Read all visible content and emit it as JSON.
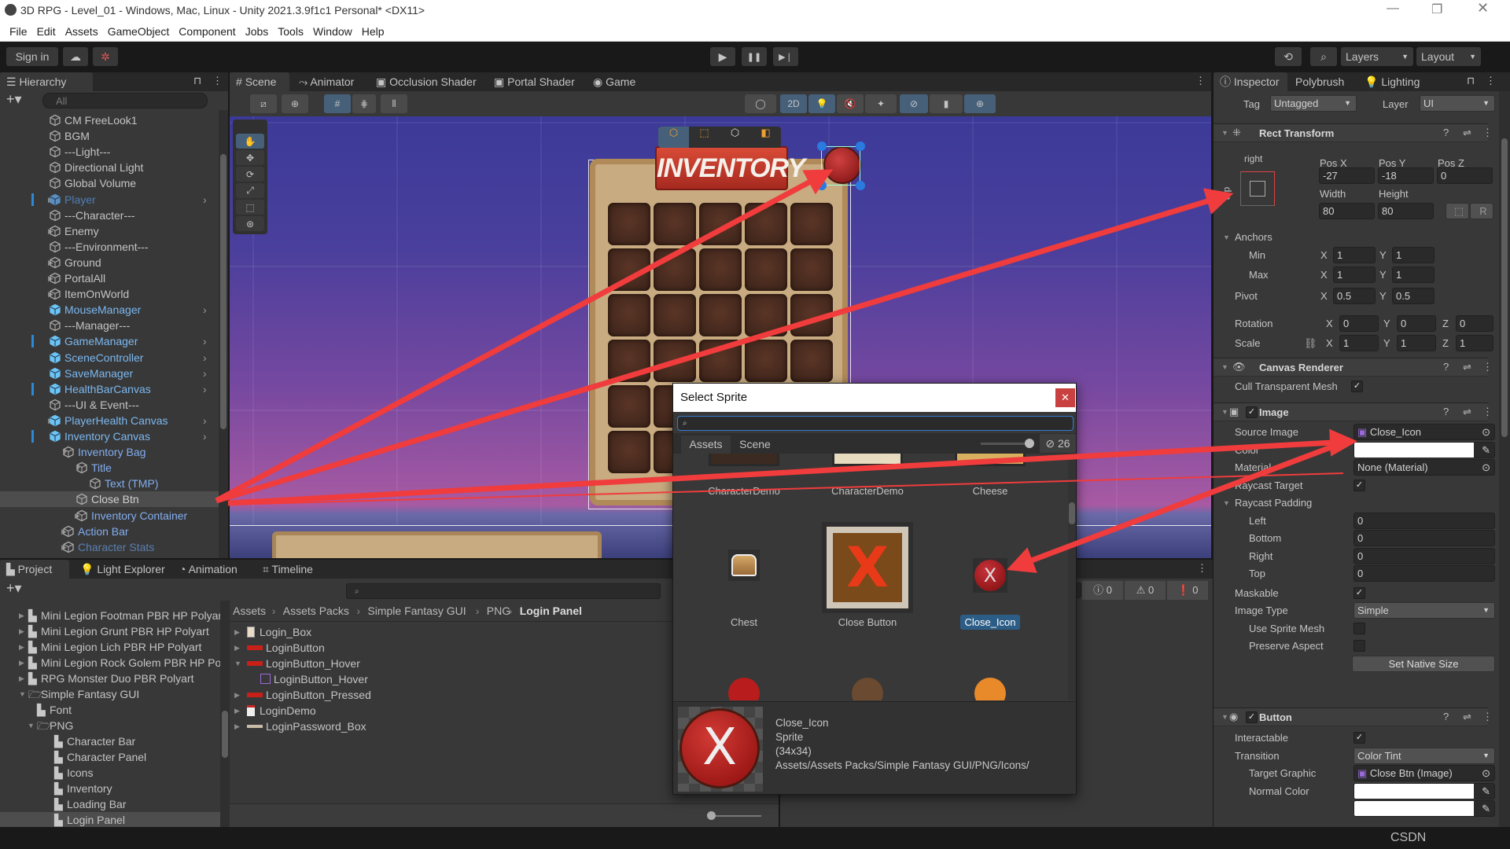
{
  "window": {
    "title": "3D RPG - Level_01 - Windows, Mac, Linux - Unity 2021.3.9f1c1 Personal* <DX11>"
  },
  "menu": [
    "File",
    "Edit",
    "Assets",
    "GameObject",
    "Component",
    "Jobs",
    "Tools",
    "Window",
    "Help"
  ],
  "toolbar": {
    "sign_in": "Sign in",
    "layers": "Layers",
    "layout": "Layout"
  },
  "hierarchy": {
    "tab": "Hierarchy",
    "search_placeholder": "All",
    "items": [
      {
        "label": "CM FreeLook1",
        "depth": 0,
        "kind": "normal"
      },
      {
        "label": "BGM",
        "depth": 0,
        "kind": "normal"
      },
      {
        "label": "---Light---",
        "depth": 0,
        "kind": "normal"
      },
      {
        "label": "Directional Light",
        "depth": 0,
        "kind": "normal"
      },
      {
        "label": "Global Volume",
        "depth": 0,
        "kind": "normal"
      },
      {
        "label": "Player",
        "depth": 0,
        "kind": "prefab-dim",
        "arrow": "right",
        "chevron": true,
        "bar": true
      },
      {
        "label": "---Character---",
        "depth": 0,
        "kind": "normal"
      },
      {
        "label": "Enemy",
        "depth": 0,
        "kind": "normal",
        "arrow": "right"
      },
      {
        "label": "---Environment---",
        "depth": 0,
        "kind": "normal"
      },
      {
        "label": "Ground",
        "depth": 0,
        "kind": "normal",
        "arrow": "right"
      },
      {
        "label": "PortalAll",
        "depth": 0,
        "kind": "normal",
        "arrow": "right"
      },
      {
        "label": "ItemOnWorld",
        "depth": 0,
        "kind": "normal",
        "arrow": "right"
      },
      {
        "label": "MouseManager",
        "depth": 0,
        "kind": "prefab",
        "chevron": true
      },
      {
        "label": "---Manager---",
        "depth": 0,
        "kind": "normal"
      },
      {
        "label": "GameManager",
        "depth": 0,
        "kind": "prefab",
        "chevron": true,
        "bar": true
      },
      {
        "label": "SceneController",
        "depth": 0,
        "kind": "prefab",
        "chevron": true
      },
      {
        "label": "SaveManager",
        "depth": 0,
        "kind": "prefab",
        "chevron": true
      },
      {
        "label": "HealthBarCanvas",
        "depth": 0,
        "kind": "prefab",
        "chevron": true,
        "bar": true
      },
      {
        "label": "---UI & Event---",
        "depth": 0,
        "kind": "normal"
      },
      {
        "label": "PlayerHealth Canvas",
        "depth": 0,
        "kind": "prefab",
        "arrow": "right",
        "chevron": true
      },
      {
        "label": "Inventory Canvas",
        "depth": 0,
        "kind": "prefab",
        "arrow": "down",
        "chevron": true,
        "bar": true
      },
      {
        "label": "Inventory Bag",
        "depth": 1,
        "kind": "child",
        "arrow": "down"
      },
      {
        "label": "Title",
        "depth": 2,
        "kind": "child",
        "arrow": "down"
      },
      {
        "label": "Text (TMP)",
        "depth": 3,
        "kind": "child"
      },
      {
        "label": "Close Btn",
        "depth": 2,
        "kind": "selected"
      },
      {
        "label": "Inventory Container",
        "depth": 2,
        "kind": "child",
        "arrow": "right"
      },
      {
        "label": "Action Bar",
        "depth": 1,
        "kind": "child",
        "arrow": "right"
      },
      {
        "label": "Character Stats",
        "depth": 1,
        "kind": "child-dim",
        "arrow": "right"
      }
    ]
  },
  "scene": {
    "tabs": [
      "Scene",
      "Animator",
      "Occlusion Shader",
      "Portal Shader",
      "Game"
    ],
    "mode_2d": "2D",
    "inventory_title": "INVENTORY"
  },
  "project": {
    "tabs": [
      "Project",
      "Light Explorer",
      "Animation",
      "Timeline"
    ],
    "tree": [
      {
        "label": "Mini Legion Footman PBR HP Polyart",
        "depth": 1,
        "arrow": "right"
      },
      {
        "label": "Mini Legion Grunt PBR HP Polyart",
        "depth": 1,
        "arrow": "right"
      },
      {
        "label": "Mini Legion Lich PBR HP Polyart",
        "depth": 1,
        "arrow": "right"
      },
      {
        "label": "Mini Legion Rock Golem PBR HP Polyart",
        "depth": 1,
        "arrow": "right"
      },
      {
        "label": "RPG Monster Duo PBR Polyart",
        "depth": 1,
        "arrow": "right"
      },
      {
        "label": "Simple Fantasy GUI",
        "depth": 1,
        "arrow": "down",
        "open": true
      },
      {
        "label": "Font",
        "depth": 2
      },
      {
        "label": "PNG",
        "depth": 2,
        "arrow": "down",
        "open": true
      },
      {
        "label": "Character Bar",
        "depth": 3
      },
      {
        "label": "Character Panel",
        "depth": 3
      },
      {
        "label": "Icons",
        "depth": 3
      },
      {
        "label": "Inventory",
        "depth": 3
      },
      {
        "label": "Loading Bar",
        "depth": 3
      },
      {
        "label": "Login Panel",
        "depth": 3,
        "selected": true
      }
    ],
    "breadcrumb": [
      "Assets",
      "Assets Packs",
      "Simple Fantasy GUI",
      "PNG",
      "Login Panel"
    ],
    "files": [
      {
        "label": "Login_Box",
        "arrow": "right",
        "icon": "box"
      },
      {
        "label": "LoginButton",
        "arrow": "right",
        "icon": "red-bar"
      },
      {
        "label": "LoginButton_Hover",
        "arrow": "down",
        "icon": "red-bar"
      },
      {
        "label": "LoginButton_Hover",
        "icon": "sprite",
        "depth": 1
      },
      {
        "label": "LoginButton_Pressed",
        "arrow": "right",
        "icon": "red-bar"
      },
      {
        "label": "LoginDemo",
        "arrow": "right",
        "icon": "demo"
      },
      {
        "label": "LoginPassword_Box",
        "arrow": "right",
        "icon": "gray-bar"
      }
    ]
  },
  "console": {
    "info": "0",
    "warnings": "0",
    "errors": "0"
  },
  "dialog": {
    "title": "Select Sprite",
    "tabs": [
      "Assets",
      "Scene"
    ],
    "hidden_count": "26",
    "items": [
      {
        "label": "CharacterDemo",
        "thumb": "character-portrait"
      },
      {
        "label": "CharacterDemo",
        "thumb": "character-sheet"
      },
      {
        "label": "Cheese",
        "thumb": "cheese"
      },
      {
        "label": "Chest",
        "thumb": "chest"
      },
      {
        "label": "Close Button",
        "thumb": "close-button"
      },
      {
        "label": "Close_Icon",
        "thumb": "close-icon",
        "selected": true
      }
    ],
    "preview": {
      "name": "Close_Icon",
      "type": "Sprite",
      "size": "(34x34)",
      "path": "Assets/Assets Packs/Simple Fantasy GUI/PNG/Icons/"
    }
  },
  "inspector": {
    "tabs": [
      "Inspector",
      "Polybrush",
      "Lighting"
    ],
    "tag_label": "Tag",
    "tag": "Untagged",
    "layer_label": "Layer",
    "layer": "UI",
    "axes": [
      "X",
      "Y",
      "Z"
    ],
    "rect": {
      "title": "Rect Transform",
      "anchor_h": "right",
      "anchor_v": "top",
      "pos_x_label": "Pos X",
      "pos_x": "-27",
      "pos_y_label": "Pos Y",
      "pos_y": "-18",
      "pos_z_label": "Pos Z",
      "pos_z": "0",
      "width_label": "Width",
      "width": "80",
      "height_label": "Height",
      "height": "80",
      "r_label": "R",
      "anchors_label": "Anchors",
      "min_label": "Min",
      "min_x": "1",
      "min_y": "1",
      "max_label": "Max",
      "max_x": "1",
      "max_y": "1",
      "pivot_label": "Pivot",
      "pivot_x": "0.5",
      "pivot_y": "0.5",
      "rotation_label": "Rotation",
      "rotation": [
        "0",
        "0",
        "0"
      ],
      "scale_label": "Scale",
      "scale": [
        "1",
        "1",
        "1"
      ]
    },
    "canvas_renderer": {
      "title": "Canvas Renderer",
      "cull_label": "Cull Transparent Mesh",
      "cull": true
    },
    "image": {
      "title": "Image",
      "enabled": true,
      "source_label": "Source Image",
      "source": "Close_Icon",
      "color_label": "Color",
      "color": "#ffffff",
      "material_label": "Material",
      "material": "None (Material)",
      "raycast_target_label": "Raycast Target",
      "raycast_target": true,
      "padding_label": "Raycast Padding",
      "padding": [
        {
          "label": "Left",
          "value": "0"
        },
        {
          "label": "Bottom",
          "value": "0"
        },
        {
          "label": "Right",
          "value": "0"
        },
        {
          "label": "Top",
          "value": "0"
        }
      ],
      "maskable_label": "Maskable",
      "maskable": true,
      "type_label": "Image Type",
      "type": "Simple",
      "sprite_mesh_label": "Use Sprite Mesh",
      "sprite_mesh": false,
      "preserve_label": "Preserve Aspect",
      "preserve": false,
      "native_size": "Set Native Size"
    },
    "button": {
      "title": "Button",
      "enabled": true,
      "interactable_label": "Interactable",
      "interactable": true,
      "transition_label": "Transition",
      "transition": "Color Tint",
      "target_label": "Target Graphic",
      "target": "Close Btn (Image)",
      "normal_label": "Normal Color",
      "normal_color": "#ffffff"
    }
  },
  "watermark": "CSDN",
  "colors": {
    "prefab": "#7cb8f0",
    "child": "#82aef0",
    "annotation": "#f03c3c",
    "selection": "#2c5d87"
  }
}
